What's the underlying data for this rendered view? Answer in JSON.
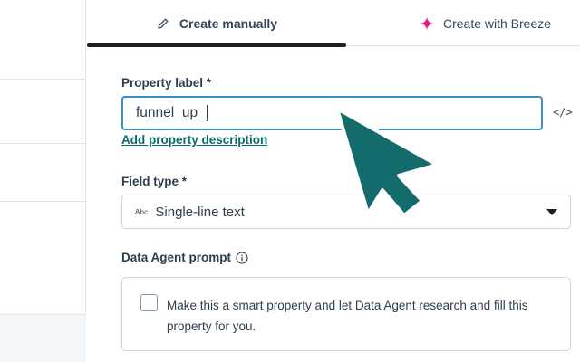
{
  "tabs": [
    {
      "label": "Create manually",
      "icon": "pencil-icon",
      "active": true
    },
    {
      "label": "Create with Breeze",
      "icon": "sparkle-icon",
      "active": false
    }
  ],
  "form": {
    "property_label": {
      "label": "Property label *",
      "value": "funnel_up_"
    },
    "code_toggle": "</>",
    "add_description_link": "Add property description",
    "field_type": {
      "label": "Field type *",
      "type_glyph": "Abc",
      "value": "Single-line text"
    },
    "data_agent": {
      "label": "Data Agent prompt",
      "checkbox_checked": false,
      "checkbox_text": "Make this a smart property and let Data Agent research and fill this property for you."
    }
  },
  "colors": {
    "accent_focus": "#3e8ec9",
    "link": "#0b6a6a",
    "cursor": "#136b6b",
    "breeze_sparkle": "#e6197b"
  }
}
